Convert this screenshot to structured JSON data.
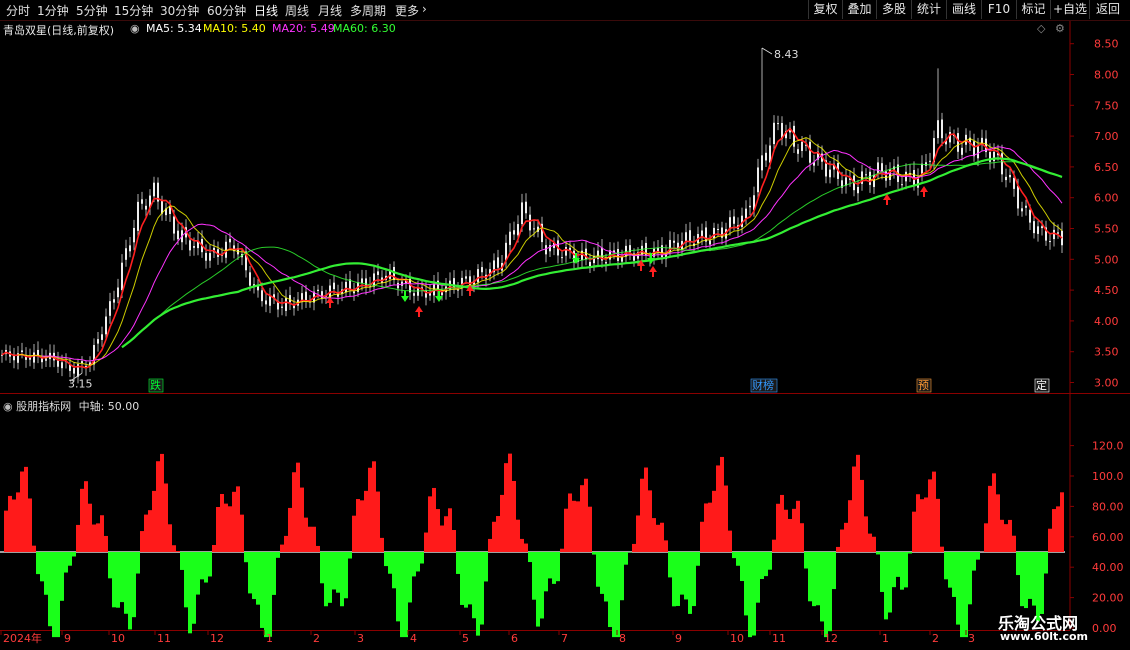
{
  "toolbar": {
    "periods": [
      {
        "label": "分时"
      },
      {
        "label": "1分钟"
      },
      {
        "label": "5分钟"
      },
      {
        "label": "15分钟"
      },
      {
        "label": "30分钟"
      },
      {
        "label": "60分钟"
      },
      {
        "label": "日线",
        "active": true
      },
      {
        "label": "周线"
      },
      {
        "label": "月线"
      },
      {
        "label": "多周期"
      },
      {
        "label": "更多"
      }
    ],
    "buttons": [
      "复权",
      "叠加",
      "多股",
      "统计",
      "画线",
      "F10",
      "标记",
      "+自选",
      "返回"
    ]
  },
  "legend": {
    "title": "青岛双星(日线,前复权)",
    "items": [
      {
        "text": "MA5: 5.34",
        "color": "#ffffff"
      },
      {
        "text": "MA10: 5.40",
        "color": "#ffff00"
      },
      {
        "text": "MA20: 5.49",
        "color": "#ff33ff"
      },
      {
        "text": "MA60: 6.30",
        "color": "#33ff33"
      }
    ]
  },
  "indicator": {
    "title": "股朋指标网",
    "middle_label": "中轴: 50.00"
  },
  "price_axis": [
    "8.50",
    "8.00",
    "7.50",
    "7.00",
    "6.50",
    "6.00",
    "5.50",
    "5.00",
    "4.50",
    "4.00",
    "3.50",
    "3.00"
  ],
  "indicator_axis": [
    "120.0",
    "100.0",
    "80.00",
    "60.00",
    "40.00",
    "20.00",
    "0.00"
  ],
  "time_axis": [
    "2024年",
    "9",
    "10",
    "11",
    "12",
    "1",
    "2",
    "3",
    "4",
    "5",
    "6",
    "7",
    "8",
    "9",
    "10",
    "11",
    "12",
    "1",
    "2",
    "3"
  ],
  "annotations": {
    "high": "8.43",
    "low": "3.15"
  },
  "event_markers": [
    {
      "label": "跌",
      "color": "#00ff33"
    },
    {
      "label": "财榜",
      "color": "#3399ff"
    },
    {
      "label": "预",
      "color": "#ff9933"
    },
    {
      "label": "定",
      "color": "#ffffff"
    }
  ],
  "watermark": {
    "line1": "乐淘公式网",
    "line2": "www.60lt.com"
  },
  "colors": {
    "up": "#ff1a1a",
    "down": "#1aff1a",
    "axis": "#8a0000",
    "grid": "#5a0000"
  }
}
